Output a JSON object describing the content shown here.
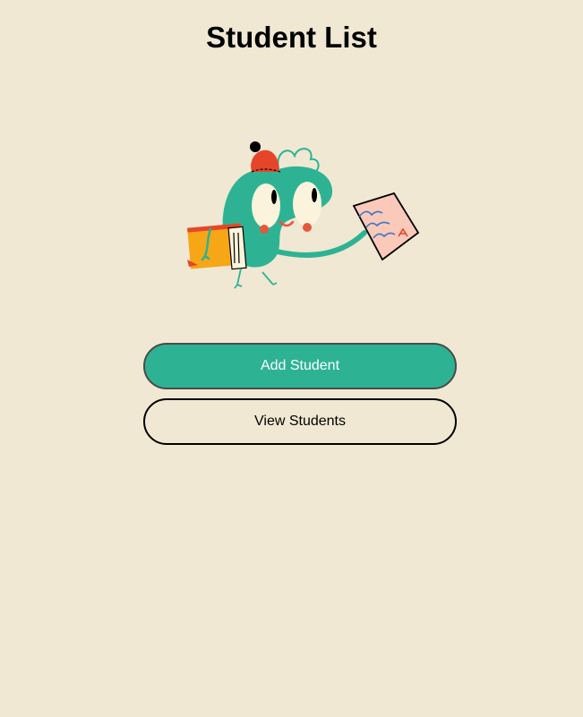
{
  "header": {
    "title": "Student List"
  },
  "illustration": {
    "icon": "student-mascot-illustration",
    "description_icon": "green-character-carrying-books-and-paper"
  },
  "actions": {
    "add_label": "Add Student",
    "view_label": "View Students"
  },
  "colors": {
    "background": "#f0e8d3",
    "accent": "#2db394",
    "text": "#000000"
  }
}
